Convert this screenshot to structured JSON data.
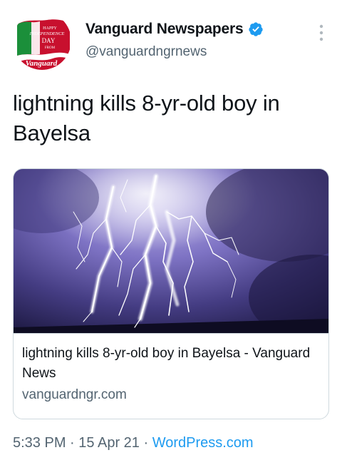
{
  "user": {
    "display_name": "Vanguard Newspapers",
    "handle": "@vanguardngrnews",
    "avatar_text": {
      "line1": "HAPPY",
      "line2": "INDEPENDENCE",
      "line3": "DAY",
      "line4": "FROM",
      "brand": "Vanguard"
    },
    "verified_icon": "verified-badge-icon",
    "more_icon": "more-vertical-icon"
  },
  "tweet": {
    "text": "lightning kills 8-yr-old boy in Bayelsa"
  },
  "card": {
    "image_icon": "lightning-photo",
    "title": "lightning kills 8-yr-old boy in Bayelsa - Vanguard News",
    "domain": "vanguardngr.com"
  },
  "meta": {
    "time": "5:33 PM",
    "separator": "·",
    "date": "15 Apr 21",
    "source": "WordPress.com"
  },
  "colors": {
    "text": "#0f1419",
    "secondary": "#536471",
    "link": "#1d9bf0",
    "verified": "#1d9bf0",
    "border": "#cfd9de"
  }
}
